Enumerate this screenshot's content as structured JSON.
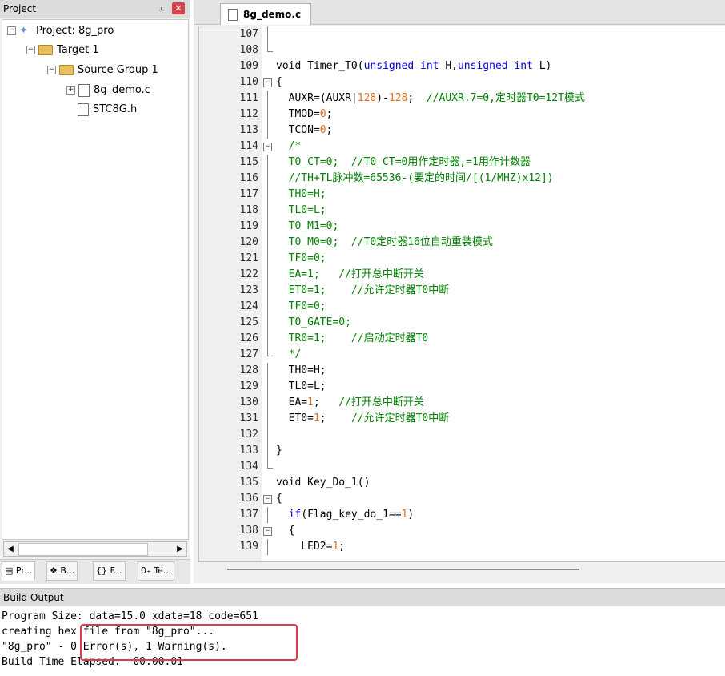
{
  "project_panel": {
    "title": "Project",
    "pin_icon": "pin-icon",
    "close_icon": "close-icon",
    "tree": [
      {
        "label": "Project: 8g_pro",
        "icon": "project-icon",
        "expanded": true
      },
      {
        "label": "Target 1",
        "icon": "target-folder-icon",
        "expanded": true
      },
      {
        "label": "Source Group 1",
        "icon": "folder-icon",
        "expanded": true
      },
      {
        "label": "8g_demo.c",
        "icon": "file-icon",
        "expandable": true
      },
      {
        "label": "STC8G.h",
        "icon": "file-icon",
        "expandable": false
      }
    ],
    "tabs": [
      {
        "label": "Pr...",
        "icon": "project-tab-icon",
        "active": true
      },
      {
        "label": "B...",
        "icon": "books-tab-icon"
      },
      {
        "label": "F...",
        "icon": "functions-tab-icon"
      },
      {
        "label": "Te...",
        "icon": "templates-tab-icon"
      }
    ]
  },
  "editor": {
    "tab_label": "8g_demo.c",
    "lines": [
      {
        "n": "107",
        "fold": "line",
        "segs": []
      },
      {
        "n": "108",
        "fold": "end",
        "segs": []
      },
      {
        "n": "109",
        "segs": [
          {
            "t": "void Timer_T0("
          },
          {
            "t": "unsigned int",
            "c": "kw"
          },
          {
            "t": " H,"
          },
          {
            "t": "unsigned int",
            "c": "kw"
          },
          {
            "t": " L)"
          }
        ]
      },
      {
        "n": "110",
        "fold": "box",
        "segs": [
          {
            "t": "{"
          }
        ]
      },
      {
        "n": "111",
        "fold": "line",
        "segs": [
          {
            "t": "  AUXR=(AUXR|"
          },
          {
            "t": "128",
            "c": "num"
          },
          {
            "t": ")-"
          },
          {
            "t": "128",
            "c": "num"
          },
          {
            "t": ";  "
          },
          {
            "t": "//AUXR.7=0,定时器T0=12T模式",
            "c": "cm"
          }
        ]
      },
      {
        "n": "112",
        "fold": "line",
        "segs": [
          {
            "t": "  TMOD="
          },
          {
            "t": "0",
            "c": "num"
          },
          {
            "t": ";"
          }
        ]
      },
      {
        "n": "113",
        "fold": "line",
        "segs": [
          {
            "t": "  TCON="
          },
          {
            "t": "0",
            "c": "num"
          },
          {
            "t": ";"
          }
        ]
      },
      {
        "n": "114",
        "fold": "box",
        "segs": [
          {
            "t": "  /*",
            "c": "cm"
          }
        ]
      },
      {
        "n": "115",
        "fold": "line",
        "segs": [
          {
            "t": "  T0_CT=0;  //T0_CT=0用作定时器,=1用作计数器",
            "c": "cm"
          }
        ]
      },
      {
        "n": "116",
        "fold": "line",
        "segs": [
          {
            "t": "  //TH+TL脉冲数=65536-(要定的时间/[(1/MHZ)x12])",
            "c": "cm"
          }
        ]
      },
      {
        "n": "117",
        "fold": "line",
        "segs": [
          {
            "t": "  TH0=H;",
            "c": "cm"
          }
        ]
      },
      {
        "n": "118",
        "fold": "line",
        "segs": [
          {
            "t": "  TL0=L;",
            "c": "cm"
          }
        ]
      },
      {
        "n": "119",
        "fold": "line",
        "segs": [
          {
            "t": "  T0_M1=0;",
            "c": "cm"
          }
        ]
      },
      {
        "n": "120",
        "fold": "line",
        "segs": [
          {
            "t": "  T0_M0=0;  //T0定时器16位自动重装模式",
            "c": "cm"
          }
        ]
      },
      {
        "n": "121",
        "fold": "line",
        "segs": [
          {
            "t": "  TF0=0;",
            "c": "cm"
          }
        ]
      },
      {
        "n": "122",
        "fold": "line",
        "segs": [
          {
            "t": "  EA=1;   //打开总中断开关",
            "c": "cm"
          }
        ]
      },
      {
        "n": "123",
        "fold": "line",
        "segs": [
          {
            "t": "  ET0=1;    //允许定时器T0中断",
            "c": "cm"
          }
        ]
      },
      {
        "n": "124",
        "fold": "line",
        "segs": [
          {
            "t": "  TF0=0;",
            "c": "cm"
          }
        ]
      },
      {
        "n": "125",
        "fold": "line",
        "segs": [
          {
            "t": "  T0_GATE=0;",
            "c": "cm"
          }
        ]
      },
      {
        "n": "126",
        "fold": "line",
        "segs": [
          {
            "t": "  TR0=1;    //启动定时器T0",
            "c": "cm"
          }
        ]
      },
      {
        "n": "127",
        "fold": "end",
        "segs": [
          {
            "t": "  */",
            "c": "cm"
          }
        ]
      },
      {
        "n": "128",
        "fold": "line",
        "segs": [
          {
            "t": "  TH0=H;"
          }
        ]
      },
      {
        "n": "129",
        "fold": "line",
        "segs": [
          {
            "t": "  TL0=L;"
          }
        ]
      },
      {
        "n": "130",
        "fold": "line",
        "segs": [
          {
            "t": "  EA="
          },
          {
            "t": "1",
            "c": "num"
          },
          {
            "t": ";   "
          },
          {
            "t": "//打开总中断开关",
            "c": "cm"
          }
        ]
      },
      {
        "n": "131",
        "fold": "line",
        "segs": [
          {
            "t": "  ET0="
          },
          {
            "t": "1",
            "c": "num"
          },
          {
            "t": ";    "
          },
          {
            "t": "//允许定时器T0中断",
            "c": "cm"
          }
        ]
      },
      {
        "n": "132",
        "fold": "line",
        "segs": []
      },
      {
        "n": "133",
        "fold": "line",
        "segs": [
          {
            "t": "}"
          }
        ]
      },
      {
        "n": "134",
        "fold": "end",
        "segs": []
      },
      {
        "n": "135",
        "segs": [
          {
            "t": "void Key_Do_1()"
          }
        ]
      },
      {
        "n": "136",
        "fold": "box",
        "segs": [
          {
            "t": "{"
          }
        ]
      },
      {
        "n": "137",
        "fold": "line",
        "segs": [
          {
            "t": "  "
          },
          {
            "t": "if",
            "c": "kw"
          },
          {
            "t": "(Flag_key_do_1=="
          },
          {
            "t": "1",
            "c": "num"
          },
          {
            "t": ")"
          }
        ]
      },
      {
        "n": "138",
        "fold": "box",
        "segs": [
          {
            "t": "  {"
          }
        ]
      },
      {
        "n": "139",
        "fold": "line",
        "segs": [
          {
            "t": "    LED2="
          },
          {
            "t": "1",
            "c": "num"
          },
          {
            "t": ";"
          }
        ]
      }
    ]
  },
  "build_output": {
    "title": "Build Output",
    "lines": [
      "Program Size: data=15.0 xdata=18 code=651",
      "creating hex file from \"8g_pro\"...",
      "\"8g_pro\" - 0 Error(s), 1 Warning(s).",
      "Build Time Elapsed:  00:00:01"
    ]
  }
}
